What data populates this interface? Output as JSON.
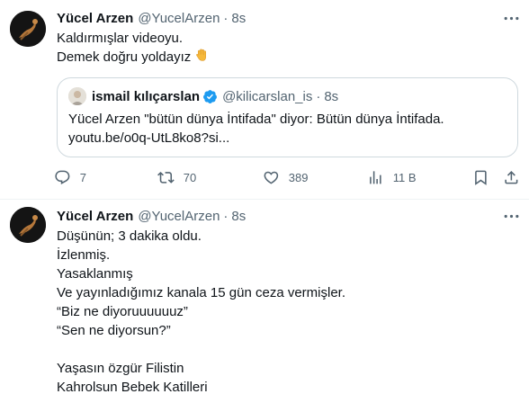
{
  "tweets": [
    {
      "author_name": "Yücel Arzen",
      "author_handle": "@YucelArzen",
      "time": "8s",
      "lines": [
        "Kaldırmışlar videoyu.",
        "Demek doğru yoldayız"
      ],
      "emoji": "waving-hand-icon",
      "quote": {
        "author_name": "ismail kılıçarslan",
        "author_handle": "@kilicarslan_is",
        "time": "8s",
        "verified": true,
        "lines": [
          "Yücel Arzen \"bütün dünya İntifada\" diyor: Bütün dünya İntifada.",
          "youtu.be/o0q-UtL8ko8?si..."
        ]
      },
      "actions": {
        "replies": "7",
        "retweets": "70",
        "likes": "389",
        "views": "11 B"
      }
    },
    {
      "author_name": "Yücel Arzen",
      "author_handle": "@YucelArzen",
      "time": "8s",
      "lines": [
        "Düşünün; 3 dakika oldu.",
        "İzlenmiş.",
        "Yasaklanmış",
        "Ve yayınladığımız kanala 15 gün ceza vermişler.",
        "“Biz ne diyoruuuuuuz”",
        "“Sen ne diyorsun?”",
        "",
        "Yaşasın özgür Filistin",
        "Kahrolsun Bebek Katilleri"
      ]
    }
  ],
  "separator": "·",
  "colors": {
    "text": "#0f1419",
    "secondary": "#536471",
    "border": "#cfd9de",
    "verified": "#1d9bf0",
    "emoji": "#f6b93b"
  }
}
